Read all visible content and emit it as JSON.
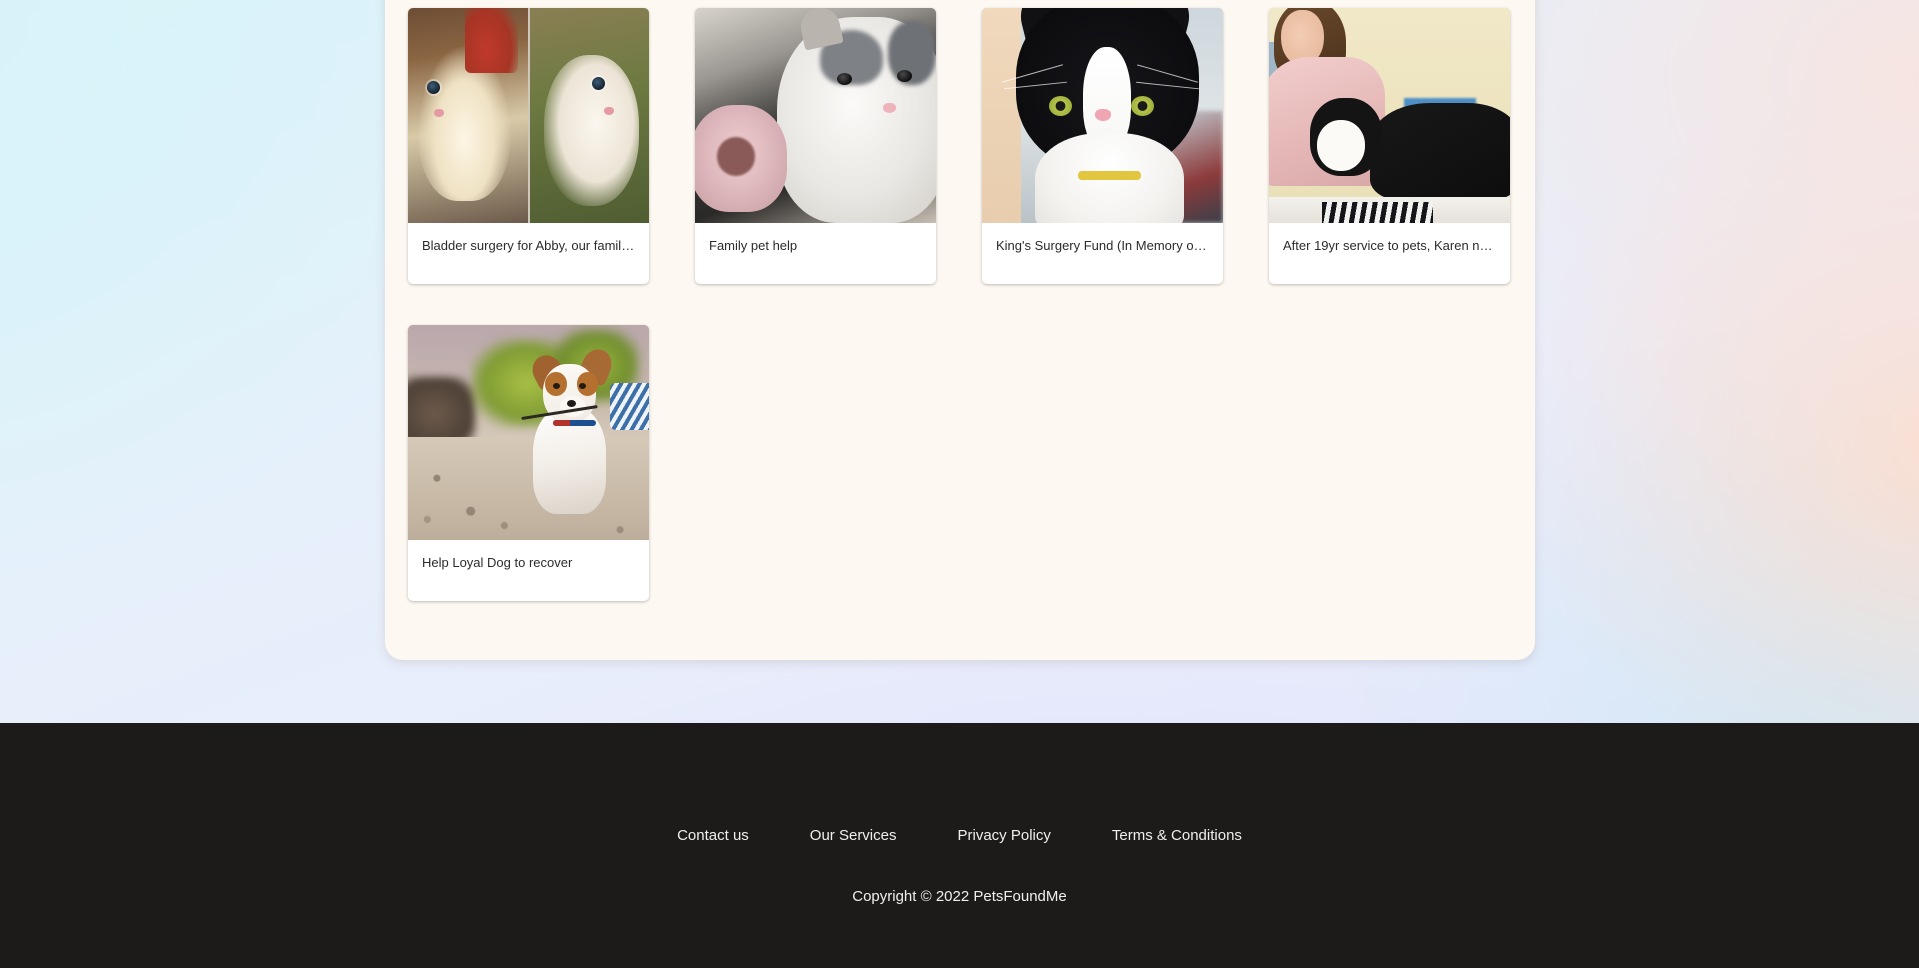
{
  "page": {
    "background_colors": {
      "top_left": "#d6f3f9",
      "top_right": "#f7e4e0",
      "mid_right": "#ffdcc8",
      "bottom": "#dde2fa"
    },
    "panel_color": "#fdf8f2",
    "card_color": "#ffffff",
    "footer_color": "#1c1b1a",
    "footer_text_color": "#f0efed"
  },
  "campaigns": [
    {
      "title": "Bladder surgery for Abby, our family…",
      "image_name": "two-kittens-collage-photo"
    },
    {
      "title": "Family pet help",
      "image_name": "grey-white-kitten-held-photo"
    },
    {
      "title": "King's Surgery Fund (In Memory of …",
      "image_name": "tuxedo-cat-closeup-photo"
    },
    {
      "title": "After 19yr service to pets, Karen ne…",
      "image_name": "woman-with-tuxedo-cat-photo"
    },
    {
      "title": "Help Loyal Dog to recover",
      "image_name": "jack-russell-with-stick-photo"
    }
  ],
  "footer": {
    "links": [
      {
        "label": "Contact us"
      },
      {
        "label": "Our Services"
      },
      {
        "label": "Privacy Policy"
      },
      {
        "label": "Terms & Conditions"
      }
    ],
    "copyright": "Copyright © 2022 PetsFoundMe"
  }
}
